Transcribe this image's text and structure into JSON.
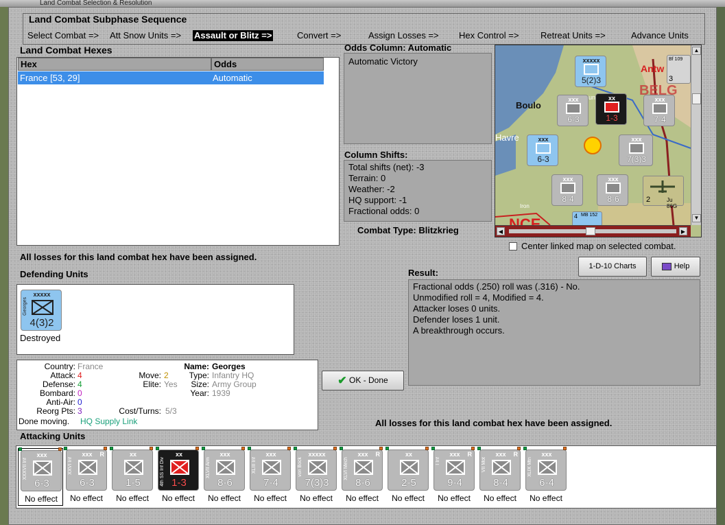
{
  "window": {
    "title": "Land Combat Selection & Resolution"
  },
  "subphase": {
    "title": "Land Combat Subphase Sequence",
    "steps": [
      "Select Combat =>",
      "Att Snow Units =>",
      "Assault or Blitz =>",
      "Convert =>",
      "Assign Losses =>",
      "Hex Control =>",
      "Retreat Units =>",
      "Advance Units"
    ],
    "active_index": 2
  },
  "hexes": {
    "title": "Land Combat Hexes",
    "columns": [
      "Hex",
      "Odds"
    ],
    "rows": [
      {
        "hex": "France [53, 29]",
        "odds": "Automatic"
      }
    ]
  },
  "odds": {
    "title": "Odds Column: Automatic",
    "text": "Automatic Victory"
  },
  "shifts": {
    "title": "Column Shifts:",
    "lines": [
      "Total shifts (net): -3",
      "Terrain: 0",
      "Weather: -2",
      "HQ support: -1",
      "Fractional odds: 0"
    ]
  },
  "combat_type": {
    "label": "Combat Type:",
    "value": "Blitzkrieg"
  },
  "map": {
    "labels": [
      "Antw",
      "BELG",
      "Boulo",
      "Havre",
      "unkirk",
      "NCE",
      "Iron"
    ],
    "units": [
      {
        "top": "xxxxx",
        "val": "5(2)3",
        "color": "blue"
      },
      {
        "top": "xxx",
        "val": "6-3",
        "color": "grey"
      },
      {
        "top": "xx",
        "val": "1-3",
        "color": "red"
      },
      {
        "top": "xxx",
        "val": "7-4",
        "color": "grey"
      },
      {
        "top": "xxx",
        "val": "6-3",
        "color": "blue"
      },
      {
        "top": "xxx",
        "val": "7(3)3",
        "color": "grey"
      },
      {
        "top": "xxx",
        "val": "8-4",
        "color": "grey"
      },
      {
        "top": "xxx",
        "val": "8-6",
        "color": "grey"
      },
      {
        "top": "Ju 86G",
        "val": "2",
        "color": "air"
      },
      {
        "top": "Bf 109",
        "val": "3",
        "color": "air"
      },
      {
        "top": "MB 152",
        "val": "4",
        "color": "air"
      }
    ]
  },
  "center_linked": {
    "label": "Center linked map on selected combat.",
    "checked": false
  },
  "buttons": {
    "charts": "1-D-10 Charts",
    "help": "Help",
    "ok": "OK - Done"
  },
  "losses_msg": "All losses for this land combat hex have been assigned.",
  "defending": {
    "title": "Defending Units",
    "units": [
      {
        "side": "Georges",
        "top": "xxxxx",
        "val": "4(3)2",
        "status": "Destroyed"
      }
    ]
  },
  "unit_info": {
    "country_label": "Country:",
    "country": "France",
    "attack_label": "Attack:",
    "attack": "4",
    "defense_label": "Defense:",
    "defense": "4",
    "bombard_label": "Bombard:",
    "bombard": "0",
    "antiair_label": "Anti-Air:",
    "antiair": "0",
    "reorg_label": "Reorg Pts:",
    "reorg": "3",
    "move_label": "Move:",
    "move": "2",
    "elite_label": "Elite:",
    "elite": "Yes",
    "cost_label": "Cost/Turns:",
    "cost": "5/3",
    "name_label": "Name:",
    "name": "Georges",
    "type_label": "Type:",
    "type": "Infantry HQ",
    "size_label": "Size:",
    "size": "Army Group",
    "year_label": "Year:",
    "year": "1939",
    "done_label": "Done moving.",
    "supply": "HQ Supply Link"
  },
  "result": {
    "title": "Result:",
    "lines": [
      "Fractional odds (.250) roll was (.316)  - No.",
      "Unmodified roll = 4, Modified = 4.",
      "Attacker loses 0 units.",
      "Defender loses 1 unit.",
      "A breakthrough occurs."
    ]
  },
  "attacking": {
    "title": "Attacking Units",
    "units": [
      {
        "side": "XXXVII Inf",
        "top": "xxx",
        "val": "6-3",
        "effect": "No effect",
        "color": "grey",
        "r": ""
      },
      {
        "side": "XXVI Inf",
        "top": "xxx",
        "val": "6-3",
        "effect": "No effect",
        "color": "grey",
        "r": "R"
      },
      {
        "side": "",
        "top": "xx",
        "val": "1-5",
        "effect": "No effect",
        "color": "grey",
        "r": ""
      },
      {
        "side": "4th SS Inf Div",
        "top": "xx",
        "val": "1-3",
        "effect": "No effect",
        "color": "red",
        "r": ""
      },
      {
        "side": "XLVII Arm",
        "top": "xxx",
        "val": "8-6",
        "effect": "No effect",
        "color": "grey",
        "r": ""
      },
      {
        "side": "XLIII Inf",
        "top": "xxx",
        "val": "7-4",
        "effect": "No effect",
        "color": "grey",
        "r": ""
      },
      {
        "side": "von Bock",
        "top": "xxxxx",
        "val": "7(3)3",
        "effect": "No effect",
        "color": "grey",
        "r": ""
      },
      {
        "side": "XLVI Mech",
        "top": "xxx",
        "val": "8-6",
        "effect": "No effect",
        "color": "grey",
        "r": "R"
      },
      {
        "side": "",
        "top": "xx",
        "val": "2-5",
        "effect": "No effect",
        "color": "grey",
        "r": ""
      },
      {
        "side": "I Inf",
        "top": "xxx",
        "val": "9-4",
        "effect": "No effect",
        "color": "grey",
        "r": "R"
      },
      {
        "side": "VII Mot",
        "top": "xxx",
        "val": "8-4",
        "effect": "No effect",
        "color": "grey",
        "r": "R"
      },
      {
        "side": "XLIX Mtn",
        "top": "xxx",
        "val": "6-4",
        "effect": "No effect",
        "color": "grey",
        "r": ""
      }
    ]
  },
  "colors": {
    "selection": "#3d8ee8",
    "panel": "#b4b4b4",
    "red_value": "#e02020",
    "green_value": "#1aa03a"
  }
}
